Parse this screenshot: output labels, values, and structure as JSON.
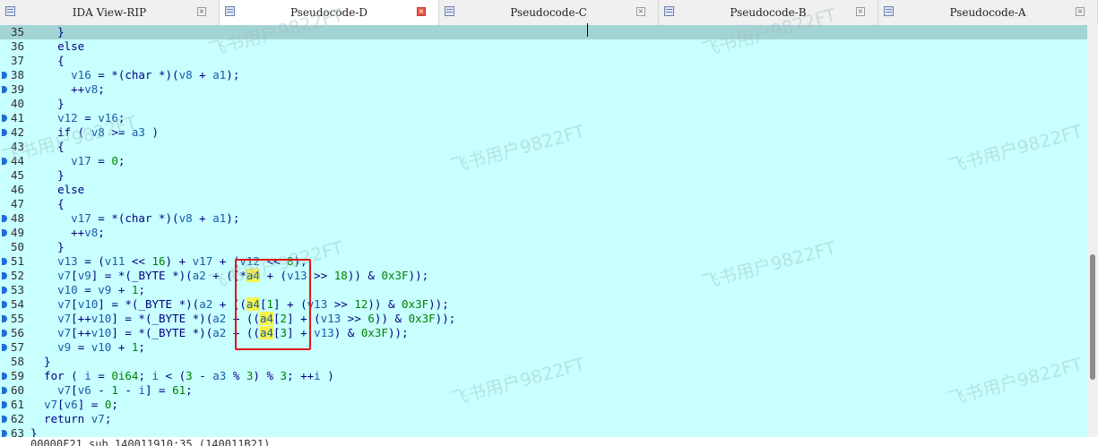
{
  "tabs": [
    {
      "label": "IDA View-RIP",
      "active": false
    },
    {
      "label": "Pseudocode-D",
      "active": true
    },
    {
      "label": "Pseudocode-C",
      "active": false
    },
    {
      "label": "Pseudocode-B",
      "active": false
    },
    {
      "label": "Pseudocode-A",
      "active": false
    }
  ],
  "watermark": "飞书用户9822FT",
  "status": "00000F21 sub_140011910:35 (140011B21)",
  "code_lines": [
    {
      "ln": "35",
      "bp": false,
      "current": true,
      "tokens": [
        [
          "op",
          "    }"
        ]
      ]
    },
    {
      "ln": "36",
      "bp": false,
      "tokens": [
        [
          "kw",
          "    else"
        ]
      ]
    },
    {
      "ln": "37",
      "bp": false,
      "tokens": [
        [
          "op",
          "    {"
        ]
      ]
    },
    {
      "ln": "38",
      "bp": true,
      "tokens": [
        [
          "op",
          "      "
        ],
        [
          "var",
          "v16"
        ],
        [
          "op",
          " = *("
        ],
        [
          "kw",
          "char"
        ],
        [
          "op",
          " *)("
        ],
        [
          "var",
          "v8"
        ],
        [
          "op",
          " + "
        ],
        [
          "var",
          "a1"
        ],
        [
          "op",
          ");"
        ]
      ]
    },
    {
      "ln": "39",
      "bp": true,
      "tokens": [
        [
          "op",
          "      ++"
        ],
        [
          "var",
          "v8"
        ],
        [
          "op",
          ";"
        ]
      ]
    },
    {
      "ln": "40",
      "bp": false,
      "tokens": [
        [
          "op",
          "    }"
        ]
      ]
    },
    {
      "ln": "41",
      "bp": true,
      "tokens": [
        [
          "op",
          "    "
        ],
        [
          "var",
          "v12"
        ],
        [
          "op",
          " = "
        ],
        [
          "var",
          "v16"
        ],
        [
          "op",
          ";"
        ]
      ]
    },
    {
      "ln": "42",
      "bp": true,
      "tokens": [
        [
          "kw",
          "    if"
        ],
        [
          "op",
          " ( "
        ],
        [
          "var",
          "v8"
        ],
        [
          "op",
          " >= "
        ],
        [
          "var",
          "a3"
        ],
        [
          "op",
          " )"
        ]
      ]
    },
    {
      "ln": "43",
      "bp": false,
      "tokens": [
        [
          "op",
          "    {"
        ]
      ]
    },
    {
      "ln": "44",
      "bp": true,
      "tokens": [
        [
          "op",
          "      "
        ],
        [
          "var",
          "v17"
        ],
        [
          "op",
          " = "
        ],
        [
          "num",
          "0"
        ],
        [
          "op",
          ";"
        ]
      ]
    },
    {
      "ln": "45",
      "bp": false,
      "tokens": [
        [
          "op",
          "    }"
        ]
      ]
    },
    {
      "ln": "46",
      "bp": false,
      "tokens": [
        [
          "kw",
          "    else"
        ]
      ]
    },
    {
      "ln": "47",
      "bp": false,
      "tokens": [
        [
          "op",
          "    {"
        ]
      ]
    },
    {
      "ln": "48",
      "bp": true,
      "tokens": [
        [
          "op",
          "      "
        ],
        [
          "var",
          "v17"
        ],
        [
          "op",
          " = *("
        ],
        [
          "kw",
          "char"
        ],
        [
          "op",
          " *)("
        ],
        [
          "var",
          "v8"
        ],
        [
          "op",
          " + "
        ],
        [
          "var",
          "a1"
        ],
        [
          "op",
          ");"
        ]
      ]
    },
    {
      "ln": "49",
      "bp": true,
      "tokens": [
        [
          "op",
          "      ++"
        ],
        [
          "var",
          "v8"
        ],
        [
          "op",
          ";"
        ]
      ]
    },
    {
      "ln": "50",
      "bp": false,
      "tokens": [
        [
          "op",
          "    }"
        ]
      ]
    },
    {
      "ln": "51",
      "bp": true,
      "tokens": [
        [
          "op",
          "    "
        ],
        [
          "var",
          "v13"
        ],
        [
          "op",
          " = ("
        ],
        [
          "var",
          "v11"
        ],
        [
          "op",
          " << "
        ],
        [
          "num",
          "16"
        ],
        [
          "op",
          ") + "
        ],
        [
          "var",
          "v17"
        ],
        [
          "op",
          " + ("
        ],
        [
          "var",
          "v12"
        ],
        [
          "op",
          " << "
        ],
        [
          "num",
          "8"
        ],
        [
          "op",
          ");"
        ]
      ]
    },
    {
      "ln": "52",
      "bp": true,
      "tokens": [
        [
          "op",
          "    "
        ],
        [
          "var",
          "v7"
        ],
        [
          "op",
          "["
        ],
        [
          "var",
          "v9"
        ],
        [
          "op",
          "] = *("
        ],
        [
          "id",
          "_BYTE"
        ],
        [
          "op",
          " *)("
        ],
        [
          "var",
          "a2"
        ],
        [
          "op",
          " + ((*"
        ],
        [
          "hl",
          "a4"
        ],
        [
          "op",
          " + ("
        ],
        [
          "var",
          "v13"
        ],
        [
          "op",
          " >> "
        ],
        [
          "num",
          "18"
        ],
        [
          "op",
          ")) & "
        ],
        [
          "num",
          "0x3F"
        ],
        [
          "op",
          "));"
        ]
      ]
    },
    {
      "ln": "53",
      "bp": true,
      "tokens": [
        [
          "op",
          "    "
        ],
        [
          "var",
          "v10"
        ],
        [
          "op",
          " = "
        ],
        [
          "var",
          "v9"
        ],
        [
          "op",
          " + "
        ],
        [
          "num",
          "1"
        ],
        [
          "op",
          ";"
        ]
      ]
    },
    {
      "ln": "54",
      "bp": true,
      "tokens": [
        [
          "op",
          "    "
        ],
        [
          "var",
          "v7"
        ],
        [
          "op",
          "["
        ],
        [
          "var",
          "v10"
        ],
        [
          "op",
          "] = *("
        ],
        [
          "id",
          "_BYTE"
        ],
        [
          "op",
          " *)("
        ],
        [
          "var",
          "a2"
        ],
        [
          "op",
          " + (("
        ],
        [
          "hl",
          "a4"
        ],
        [
          "op",
          "["
        ],
        [
          "num",
          "1"
        ],
        [
          "op",
          "] + ("
        ],
        [
          "var",
          "v13"
        ],
        [
          "op",
          " >> "
        ],
        [
          "num",
          "12"
        ],
        [
          "op",
          ")) & "
        ],
        [
          "num",
          "0x3F"
        ],
        [
          "op",
          "));"
        ]
      ]
    },
    {
      "ln": "55",
      "bp": true,
      "tokens": [
        [
          "op",
          "    "
        ],
        [
          "var",
          "v7"
        ],
        [
          "op",
          "[++"
        ],
        [
          "var",
          "v10"
        ],
        [
          "op",
          "] = *("
        ],
        [
          "id",
          "_BYTE"
        ],
        [
          "op",
          " *)("
        ],
        [
          "var",
          "a2"
        ],
        [
          "op",
          " + (("
        ],
        [
          "hl",
          "a4"
        ],
        [
          "op",
          "["
        ],
        [
          "num",
          "2"
        ],
        [
          "op",
          "] + ("
        ],
        [
          "var",
          "v13"
        ],
        [
          "op",
          " >> "
        ],
        [
          "num",
          "6"
        ],
        [
          "op",
          ")) & "
        ],
        [
          "num",
          "0x3F"
        ],
        [
          "op",
          "));"
        ]
      ]
    },
    {
      "ln": "56",
      "bp": true,
      "tokens": [
        [
          "op",
          "    "
        ],
        [
          "var",
          "v7"
        ],
        [
          "op",
          "[++"
        ],
        [
          "var",
          "v10"
        ],
        [
          "op",
          "] = *("
        ],
        [
          "id",
          "_BYTE"
        ],
        [
          "op",
          " *)("
        ],
        [
          "var",
          "a2"
        ],
        [
          "op",
          " + (("
        ],
        [
          "hl",
          "a4"
        ],
        [
          "op",
          "["
        ],
        [
          "num",
          "3"
        ],
        [
          "op",
          "] + "
        ],
        [
          "var",
          "v13"
        ],
        [
          "op",
          ") & "
        ],
        [
          "num",
          "0x3F"
        ],
        [
          "op",
          "));"
        ]
      ]
    },
    {
      "ln": "57",
      "bp": true,
      "tokens": [
        [
          "op",
          "    "
        ],
        [
          "var",
          "v9"
        ],
        [
          "op",
          " = "
        ],
        [
          "var",
          "v10"
        ],
        [
          "op",
          " + "
        ],
        [
          "num",
          "1"
        ],
        [
          "op",
          ";"
        ]
      ]
    },
    {
      "ln": "58",
      "bp": false,
      "tokens": [
        [
          "op",
          "  }"
        ]
      ]
    },
    {
      "ln": "59",
      "bp": true,
      "tokens": [
        [
          "kw",
          "  for"
        ],
        [
          "op",
          " ( "
        ],
        [
          "var",
          "i"
        ],
        [
          "op",
          " = "
        ],
        [
          "num",
          "0i64"
        ],
        [
          "op",
          "; "
        ],
        [
          "var",
          "i"
        ],
        [
          "op",
          " < ("
        ],
        [
          "num",
          "3"
        ],
        [
          "op",
          " - "
        ],
        [
          "var",
          "a3"
        ],
        [
          "op",
          " % "
        ],
        [
          "num",
          "3"
        ],
        [
          "op",
          ") % "
        ],
        [
          "num",
          "3"
        ],
        [
          "op",
          "; ++"
        ],
        [
          "var",
          "i"
        ],
        [
          "op",
          " )"
        ]
      ]
    },
    {
      "ln": "60",
      "bp": true,
      "tokens": [
        [
          "op",
          "    "
        ],
        [
          "var",
          "v7"
        ],
        [
          "op",
          "["
        ],
        [
          "var",
          "v6"
        ],
        [
          "op",
          " - "
        ],
        [
          "num",
          "1"
        ],
        [
          "op",
          " - "
        ],
        [
          "var",
          "i"
        ],
        [
          "op",
          "] = "
        ],
        [
          "num",
          "61"
        ],
        [
          "op",
          ";"
        ]
      ]
    },
    {
      "ln": "61",
      "bp": true,
      "tokens": [
        [
          "op",
          "  "
        ],
        [
          "var",
          "v7"
        ],
        [
          "op",
          "["
        ],
        [
          "var",
          "v6"
        ],
        [
          "op",
          "] = "
        ],
        [
          "num",
          "0"
        ],
        [
          "op",
          ";"
        ]
      ]
    },
    {
      "ln": "62",
      "bp": true,
      "tokens": [
        [
          "kw",
          "  return"
        ],
        [
          "op",
          " "
        ],
        [
          "var",
          "v7"
        ],
        [
          "op",
          ";"
        ]
      ]
    },
    {
      "ln": "63",
      "bp": true,
      "tokens": [
        [
          "op",
          "}"
        ]
      ]
    }
  ]
}
